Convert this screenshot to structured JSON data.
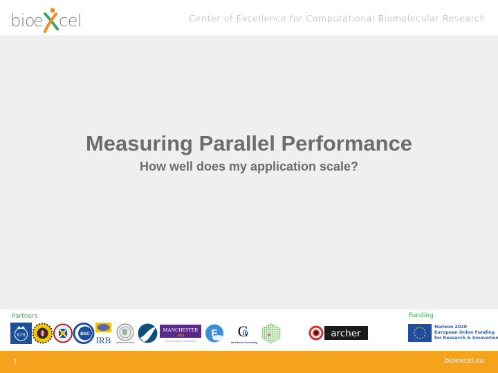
{
  "header": {
    "logo_text": "bioexcel",
    "tagline": "Center of Excellence for Computational Biomolecular Research"
  },
  "slide": {
    "title": "Measuring Parallel Performance",
    "subtitle": "How well does my application scale?"
  },
  "partners": {
    "label": "Partners",
    "logos": [
      {
        "name": "KTH",
        "icon": "kth-logo"
      },
      {
        "name": "Utrecht University",
        "icon": "utrecht-logo"
      },
      {
        "name": "University of Edinburgh",
        "icon": "edinburgh-logo"
      },
      {
        "name": "BSC",
        "icon": "bsc-logo"
      },
      {
        "name": "IRB",
        "icon": "irb-logo"
      },
      {
        "name": "Max Planck",
        "icon": "max-planck-logo"
      },
      {
        "name": "Jülich",
        "icon": "julich-logo"
      },
      {
        "name": "MANCHESTER 1824",
        "subtext": "The University of Manchester",
        "icon": "manchester-logo"
      },
      {
        "name": "Forschungszentrum",
        "icon": "ft-logo"
      },
      {
        "name": "ih",
        "subtext": "Ian Harrow Consulting",
        "icon": "ih-logo"
      },
      {
        "name": "Hexagon grid",
        "icon": "hexagon-logo"
      }
    ]
  },
  "archer": {
    "text": "archer"
  },
  "funding": {
    "label": "Funding",
    "lines": [
      "Horizon 2020",
      "European Union Funding",
      "for Research & Innovation"
    ]
  },
  "footer": {
    "slide_number": "1",
    "site": "bioexcel.eu",
    "color": "#f5a21c"
  },
  "colors": {
    "band": "#efefef",
    "title": "#6c6c6c",
    "green_label": "#2eb34a"
  }
}
